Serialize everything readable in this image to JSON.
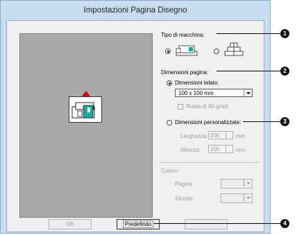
{
  "window": {
    "title": "Impostazioni Pagina Disegno"
  },
  "machine_type": {
    "label": "Tipo di macchina:",
    "option_single_selected": true,
    "option_multi_selected": false
  },
  "page_size": {
    "label": "Dimensioni pagina:",
    "hoop": {
      "label": "Dimensioni telaio:",
      "value": "100 x 100 mm",
      "selected": true
    },
    "rotate": {
      "label": "Ruota di 90 gradi",
      "checked": false
    },
    "custom": {
      "label": "Dimensioni personalizzate:",
      "selected": false,
      "width_label": "Larghezza:",
      "width_value": "200",
      "width_unit": "mm",
      "height_label": "Altezza:",
      "height_value": "200",
      "height_unit": "mm"
    }
  },
  "color": {
    "label": "Colore:",
    "page_label": "Pagina:",
    "background_label": "Sfondo:"
  },
  "buttons": {
    "ok": "OK",
    "default": "Predefinito"
  },
  "callouts": [
    "1",
    "2",
    "3",
    "4"
  ]
}
